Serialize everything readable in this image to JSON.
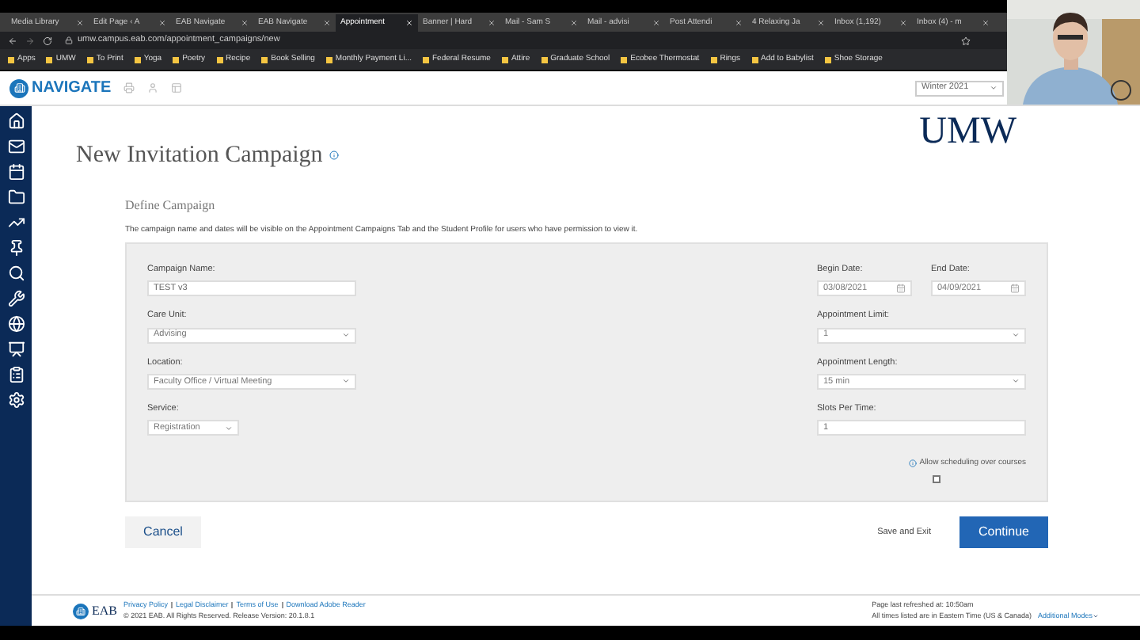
{
  "browser": {
    "tabs": [
      {
        "label": "Media Library",
        "selected": false
      },
      {
        "label": "Edit Page ‹ A",
        "selected": false
      },
      {
        "label": "EAB Navigate",
        "selected": false
      },
      {
        "label": "EAB Navigate",
        "selected": false
      },
      {
        "label": "Appointment",
        "selected": true
      },
      {
        "label": "Banner | Hard",
        "selected": false
      },
      {
        "label": "Mail - Sam S",
        "selected": false
      },
      {
        "label": "Mail - advisi",
        "selected": false
      },
      {
        "label": "Post Attendi",
        "selected": false
      },
      {
        "label": "4 Relaxing Ja",
        "selected": false
      },
      {
        "label": "Inbox (1,192)",
        "selected": false
      },
      {
        "label": "Inbox (4) - m",
        "selected": false
      }
    ],
    "url": "umw.campus.eab.com/appointment_campaigns/new",
    "bookmarks": [
      "Apps",
      "UMW",
      "To Print",
      "Yoga",
      "Poetry",
      "Recipe",
      "Book Selling",
      "Monthly Payment Li...",
      "Federal Resume",
      "Attire",
      "Graduate School",
      "Ecobee Thermostat",
      "Rings",
      "Add to Babylist",
      "Shoe Storage"
    ]
  },
  "header": {
    "brand": "NAVIGATE",
    "term": "Winter 2021"
  },
  "page": {
    "title": "New Invitation Campaign",
    "logo": "UMW",
    "section": "Define Campaign",
    "description": "The campaign name and dates will be visible on the Appointment Campaigns Tab and the Student Profile for users who have permission to view it."
  },
  "left_fields": [
    {
      "kind": "text",
      "label": "Campaign Name:",
      "value": "TEST v3"
    },
    {
      "kind": "select",
      "label": "Care Unit:",
      "value": "Advising"
    },
    {
      "kind": "select",
      "label": "Location:",
      "value": "Faculty Office / Virtual Meeting"
    },
    {
      "kind": "select",
      "label": "Service:",
      "value": "Registration"
    }
  ],
  "dates": [
    {
      "label": "Begin Date:",
      "value": "03/08/2021"
    },
    {
      "label": "End Date:",
      "value": "04/09/2021"
    }
  ],
  "right_fields": [
    {
      "kind": "select",
      "label": "Appointment Limit:",
      "value": "1"
    },
    {
      "kind": "select",
      "label": "Appointment Length:",
      "value": "15 min"
    },
    {
      "kind": "text",
      "label": "Slots Per Time:",
      "value": "1"
    }
  ],
  "allow_courses": {
    "label": "Allow scheduling over courses",
    "checked": false
  },
  "buttons": {
    "cancel": "Cancel",
    "save": "Save and Exit",
    "continue": "Continue"
  },
  "footer": {
    "brand": "EAB",
    "links": [
      "Privacy Policy",
      "Legal Disclaimer",
      "Terms of Use",
      "Download Adobe Reader"
    ],
    "copyright": "© 2021 EAB. All Rights Reserved. Release Version: 20.1.8.1",
    "refreshed": "Page last refreshed at: 10:50am",
    "timezone": "All times listed are in Eastern Time (US & Canada)",
    "modes": "Additional Modes"
  }
}
